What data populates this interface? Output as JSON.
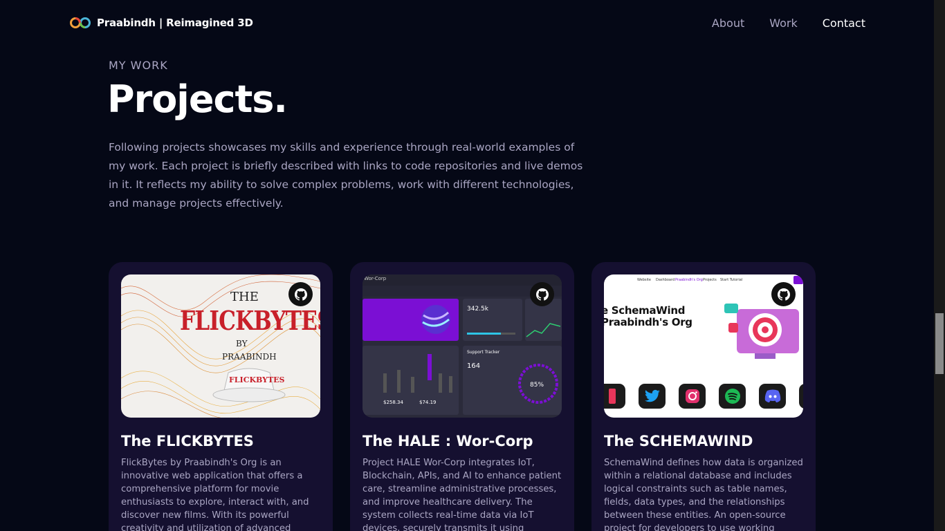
{
  "nav": {
    "brand": "Praabindh | Reimagined 3D",
    "links": [
      {
        "label": "About"
      },
      {
        "label": "Work"
      },
      {
        "label": "Contact"
      }
    ]
  },
  "section": {
    "subtitle": "MY WORK",
    "title": "Projects.",
    "intro": "Following projects showcases my skills and experience through real-world examples of my work. Each project is briefly described with links to code repositories and live demos in it. It reflects my ability to solve complex problems, work with different technologies, and manage projects effectively."
  },
  "projects": [
    {
      "name": "The FLICKBYTES",
      "description": "FlickBytes by Praabindh's Org is an innovative web application that offers a comprehensive platform for movie enthusiasts to explore, interact with, and discover new films. With its powerful creativity and utilization of advanced JavaScript tools, such as React.js,",
      "thumb": {
        "the": "THE",
        "main": "FLICKBYTES",
        "by": "BY",
        "author": "PRAABINDH",
        "hat": "FLICKBYTES"
      }
    },
    {
      "name": "The HALE : Wor-Corp",
      "description": "Project HALE Wor-Corp integrates IoT, Blockchain, APIs, and AI to enhance patient care, streamline administrative processes, and improve healthcare delivery. The system collects real-time data via IoT devices, securely transmits it using blockchain",
      "thumb": {
        "topbar": "Wor-Corp",
        "stat1": "342.5k",
        "card_title": "Support Tracker",
        "count": "164",
        "percent": "85%",
        "amount1": "$258.34",
        "amount2": "$74.19"
      }
    },
    {
      "name": "The SCHEMAWIND",
      "description": "SchemaWind defines how data is organized within a relational database and includes logical constraints such as table names, fields, data types, and the relationships between these entities. An open-source project for developers to use working schema",
      "thumb": {
        "title_line1": "e SchemaWind",
        "title_line2": "Praabindh's Org",
        "nav": [
          "Website",
          "Dashboard",
          "Praabindh's Org",
          "Projects",
          "Start Tutorial"
        ]
      }
    }
  ],
  "colors": {
    "background": "#050816",
    "card": "#151030",
    "secondary_text": "#aaa6c3",
    "accent_purple": "#7b0fd4"
  },
  "icons": {
    "brand": "infinity-logo-icon",
    "github": "github-icon"
  }
}
